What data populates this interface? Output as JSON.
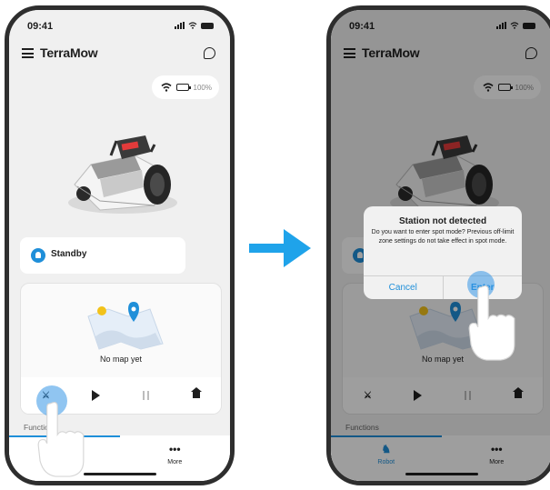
{
  "colors": {
    "accent": "#1f8fd9",
    "battery": "#3fd66a",
    "frame": "#2e2e2e",
    "arrow": "#1fa3ea"
  },
  "status_bar": {
    "time": "09:41"
  },
  "app": {
    "title": "TerraMow"
  },
  "connectivity": {
    "battery": "100%",
    "battery_level": 1.0
  },
  "device_status": {
    "label": "Standby"
  },
  "map": {
    "empty_text": "No map yet"
  },
  "controls": {
    "spot_icon": "spot-mode-icon",
    "play_icon": "play-icon",
    "pause_icon": "pause-icon",
    "home_icon": "home-icon"
  },
  "functions_label": "Functions",
  "tabs": [
    {
      "label": "Robot",
      "icon": "mower-icon"
    },
    {
      "label": "More",
      "icon": "more-dots-icon"
    }
  ],
  "dialog": {
    "title": "Station not detected",
    "message": "Do you want to enter spot mode? Previous off-limit zone settings do not take effect in  spot mode.",
    "cancel": "Cancel",
    "confirm": "Enter"
  }
}
